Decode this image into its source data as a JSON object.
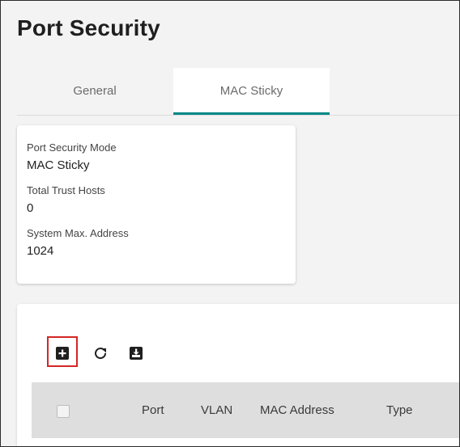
{
  "page": {
    "title": "Port Security"
  },
  "tabs": [
    {
      "label": "General",
      "active": false
    },
    {
      "label": "MAC Sticky",
      "active": true
    }
  ],
  "summary": {
    "mode_label": "Port Security Mode",
    "mode_value": "MAC Sticky",
    "hosts_label": "Total Trust Hosts",
    "hosts_value": "0",
    "max_label": "System Max. Address",
    "max_value": "1024"
  },
  "toolbar": {
    "add_icon": "add-box-icon",
    "refresh_icon": "refresh-icon",
    "export_icon": "export-icon"
  },
  "table": {
    "columns": [
      "Port",
      "VLAN",
      "MAC Address",
      "Type"
    ]
  },
  "colors": {
    "accent": "#008787",
    "highlight": "#d42626"
  }
}
